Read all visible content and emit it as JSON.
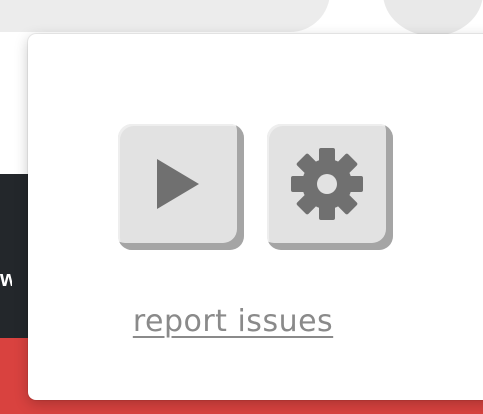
{
  "background": {
    "partial_text": "w"
  },
  "popup": {
    "play_button": {
      "icon": "play-icon"
    },
    "settings_button": {
      "icon": "gear-icon"
    },
    "report_link_label": "report issues"
  },
  "colors": {
    "button_face": "#e2e2e2",
    "button_shadow": "#a5a5a5",
    "icon": "#707070",
    "link": "#8a8a8a",
    "background_red": "#d9423f",
    "background_dark": "#23272b"
  }
}
